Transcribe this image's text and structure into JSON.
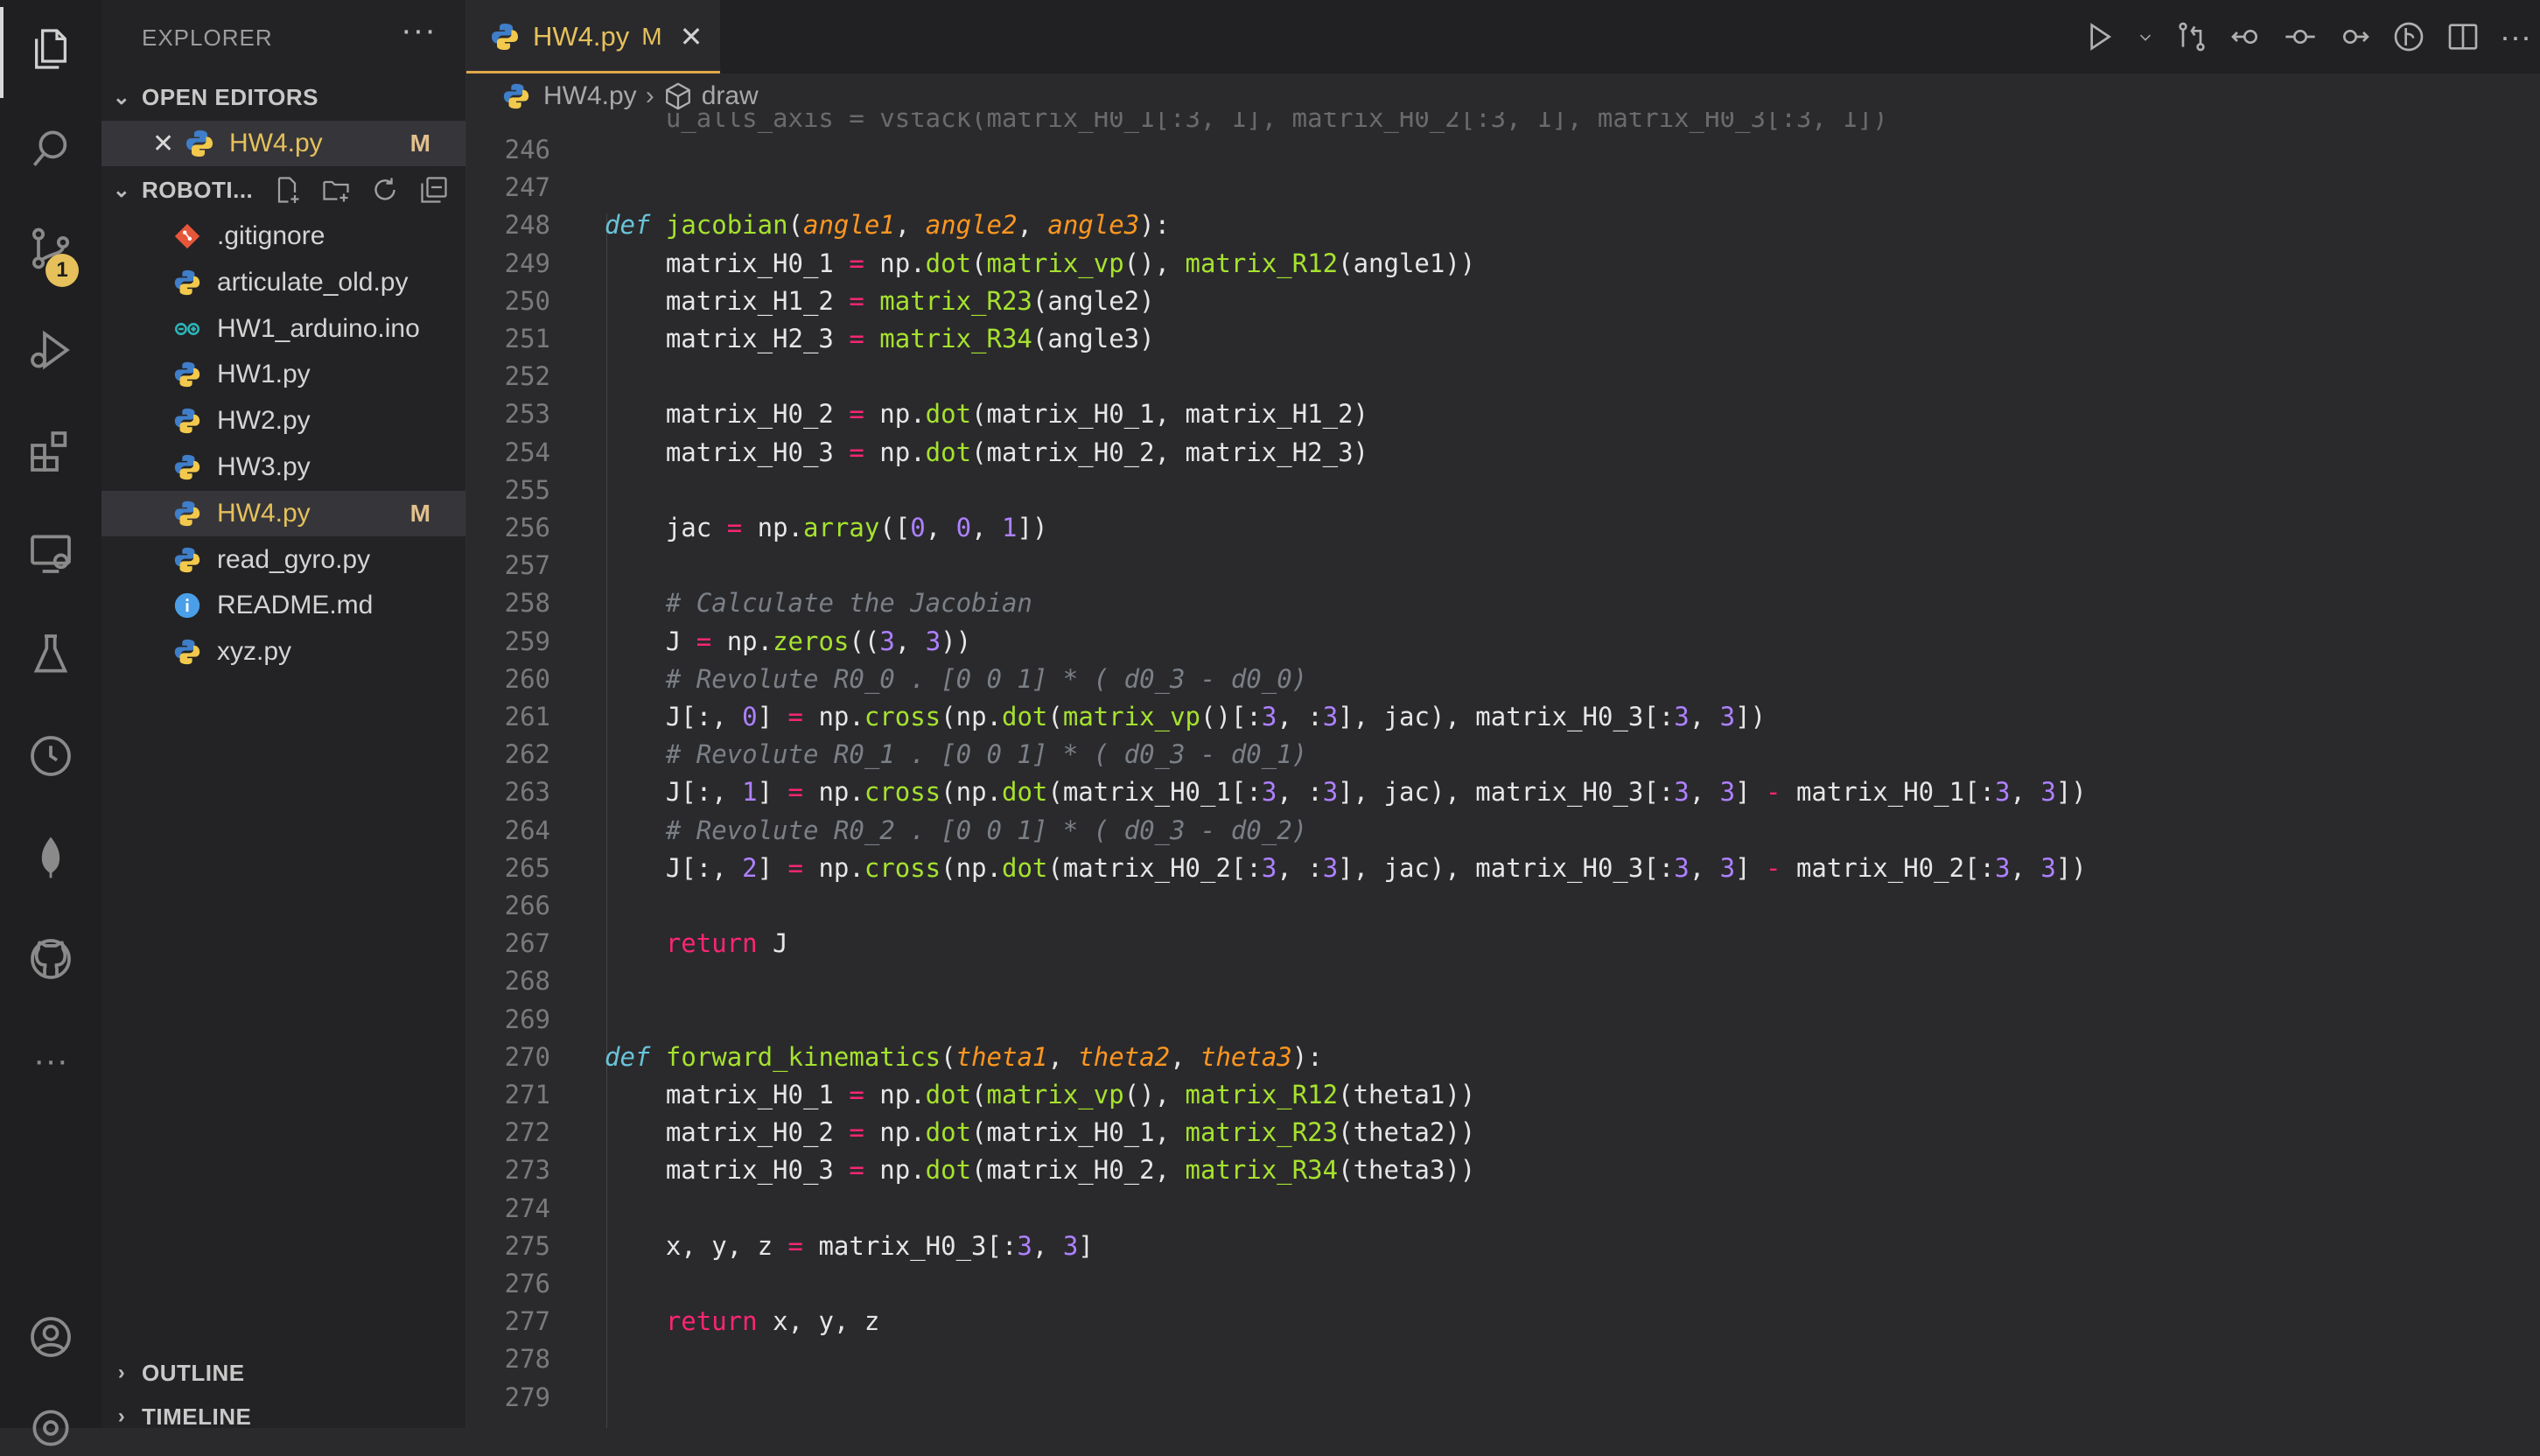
{
  "sidebar": {
    "title": "EXPLORER",
    "open_editors_label": "OPEN EDITORS",
    "open_editors": [
      {
        "name": "HW4.py",
        "badge": "M"
      }
    ],
    "folder_label": "ROBOTI...",
    "files": [
      {
        "name": ".gitignore",
        "icon": "git-icon",
        "badge": ""
      },
      {
        "name": "articulate_old.py",
        "icon": "python-icon",
        "badge": ""
      },
      {
        "name": "HW1_arduino.ino",
        "icon": "arduino-icon",
        "badge": ""
      },
      {
        "name": "HW1.py",
        "icon": "python-icon",
        "badge": ""
      },
      {
        "name": "HW2.py",
        "icon": "python-icon",
        "badge": ""
      },
      {
        "name": "HW3.py",
        "icon": "python-icon",
        "badge": ""
      },
      {
        "name": "HW4.py",
        "icon": "python-icon",
        "badge": "M"
      },
      {
        "name": "read_gyro.py",
        "icon": "python-icon",
        "badge": ""
      },
      {
        "name": "README.md",
        "icon": "info-icon",
        "badge": ""
      },
      {
        "name": "xyz.py",
        "icon": "python-icon",
        "badge": ""
      }
    ],
    "outline_label": "OUTLINE",
    "timeline_label": "TIMELINE"
  },
  "activity": {
    "scm_badge": "1"
  },
  "editor": {
    "tab": {
      "name": "HW4.py",
      "badge": "M"
    },
    "breadcrumb": {
      "file": "HW4.py",
      "symbol": "draw"
    },
    "lines": [
      {
        "n": "246",
        "t": ""
      },
      {
        "n": "247",
        "t": ""
      },
      {
        "n": "248",
        "t": "def jacobian(angle1, angle2, angle3):"
      },
      {
        "n": "249",
        "t": "    matrix_H0_1 = np.dot(matrix_vp(), matrix_R12(angle1))"
      },
      {
        "n": "250",
        "t": "    matrix_H1_2 = matrix_R23(angle2)"
      },
      {
        "n": "251",
        "t": "    matrix_H2_3 = matrix_R34(angle3)"
      },
      {
        "n": "252",
        "t": ""
      },
      {
        "n": "253",
        "t": "    matrix_H0_2 = np.dot(matrix_H0_1, matrix_H1_2)"
      },
      {
        "n": "254",
        "t": "    matrix_H0_3 = np.dot(matrix_H0_2, matrix_H2_3)"
      },
      {
        "n": "255",
        "t": ""
      },
      {
        "n": "256",
        "t": "    jac = np.array([0, 0, 1])"
      },
      {
        "n": "257",
        "t": ""
      },
      {
        "n": "258",
        "t": "    # Calculate the Jacobian"
      },
      {
        "n": "259",
        "t": "    J = np.zeros((3, 3))"
      },
      {
        "n": "260",
        "t": "    # Revolute R0_0 . [0 0 1] * ( d0_3 - d0_0)"
      },
      {
        "n": "261",
        "t": "    J[:, 0] = np.cross(np.dot(matrix_vp()[:3, :3], jac), matrix_H0_3[:3, 3])"
      },
      {
        "n": "262",
        "t": "    # Revolute R0_1 . [0 0 1] * ( d0_3 - d0_1)"
      },
      {
        "n": "263",
        "t": "    J[:, 1] = np.cross(np.dot(matrix_H0_1[:3, :3], jac), matrix_H0_3[:3, 3] - matrix_H0_1[:3, 3])"
      },
      {
        "n": "264",
        "t": "    # Revolute R0_2 . [0 0 1] * ( d0_3 - d0_2)"
      },
      {
        "n": "265",
        "t": "    J[:, 2] = np.cross(np.dot(matrix_H0_2[:3, :3], jac), matrix_H0_3[:3, 3] - matrix_H0_2[:3, 3])"
      },
      {
        "n": "266",
        "t": ""
      },
      {
        "n": "267",
        "t": "    return J"
      },
      {
        "n": "268",
        "t": ""
      },
      {
        "n": "269",
        "t": ""
      },
      {
        "n": "270",
        "t": "def forward_kinematics(theta1, theta2, theta3):"
      },
      {
        "n": "271",
        "t": "    matrix_H0_1 = np.dot(matrix_vp(), matrix_R12(theta1))"
      },
      {
        "n": "272",
        "t": "    matrix_H0_2 = np.dot(matrix_H0_1, matrix_R23(theta2))"
      },
      {
        "n": "273",
        "t": "    matrix_H0_3 = np.dot(matrix_H0_2, matrix_R34(theta3))"
      },
      {
        "n": "274",
        "t": ""
      },
      {
        "n": "275",
        "t": "    x, y, z = matrix_H0_3[:3, 3]"
      },
      {
        "n": "276",
        "t": ""
      },
      {
        "n": "277",
        "t": "    return x, y, z"
      },
      {
        "n": "278",
        "t": ""
      },
      {
        "n": "279",
        "t": ""
      }
    ]
  }
}
